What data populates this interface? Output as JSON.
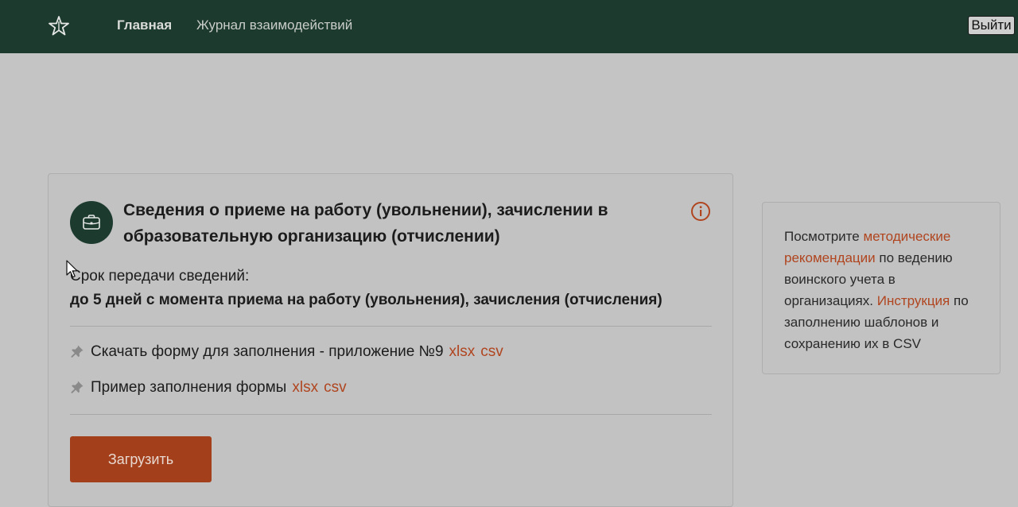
{
  "header": {
    "logo_icon": "star-emblem-icon",
    "nav": {
      "home": "Главная",
      "journal": "Журнал взаимодействий"
    },
    "logout": "Выйти",
    "background_color": "#1d3a2f"
  },
  "card": {
    "icon": "briefcase-icon",
    "title": "Сведения о приеме на работу (увольнении), зачислении в образовательную организацию (отчислении)",
    "info_icon": "info-icon",
    "deadline_label": "Срок передачи сведений:",
    "deadline_value": "до 5 дней с момента приема на работу (увольнения), зачисления (отчисления)",
    "downloads": [
      {
        "icon": "pin-icon",
        "text": "Скачать форму для заполнения - приложение №9",
        "links": [
          "xlsx",
          "csv"
        ]
      },
      {
        "icon": "pin-icon",
        "text": "Пример заполнения формы",
        "links": [
          "xlsx",
          "csv"
        ]
      }
    ],
    "upload_button": "Загрузить"
  },
  "side_panel": {
    "part1": "Посмотрите ",
    "link1": "методические рекомендации",
    "part2": " по ведению воинского учета в организациях. ",
    "link2": "Инструкция",
    "part3": " по заполнению шаблонов и сохранению их в CSV"
  },
  "colors": {
    "accent": "#a3401b",
    "link": "#b0451f",
    "dark_green": "#1d3a2f",
    "page_background": "#c4c4c4"
  }
}
